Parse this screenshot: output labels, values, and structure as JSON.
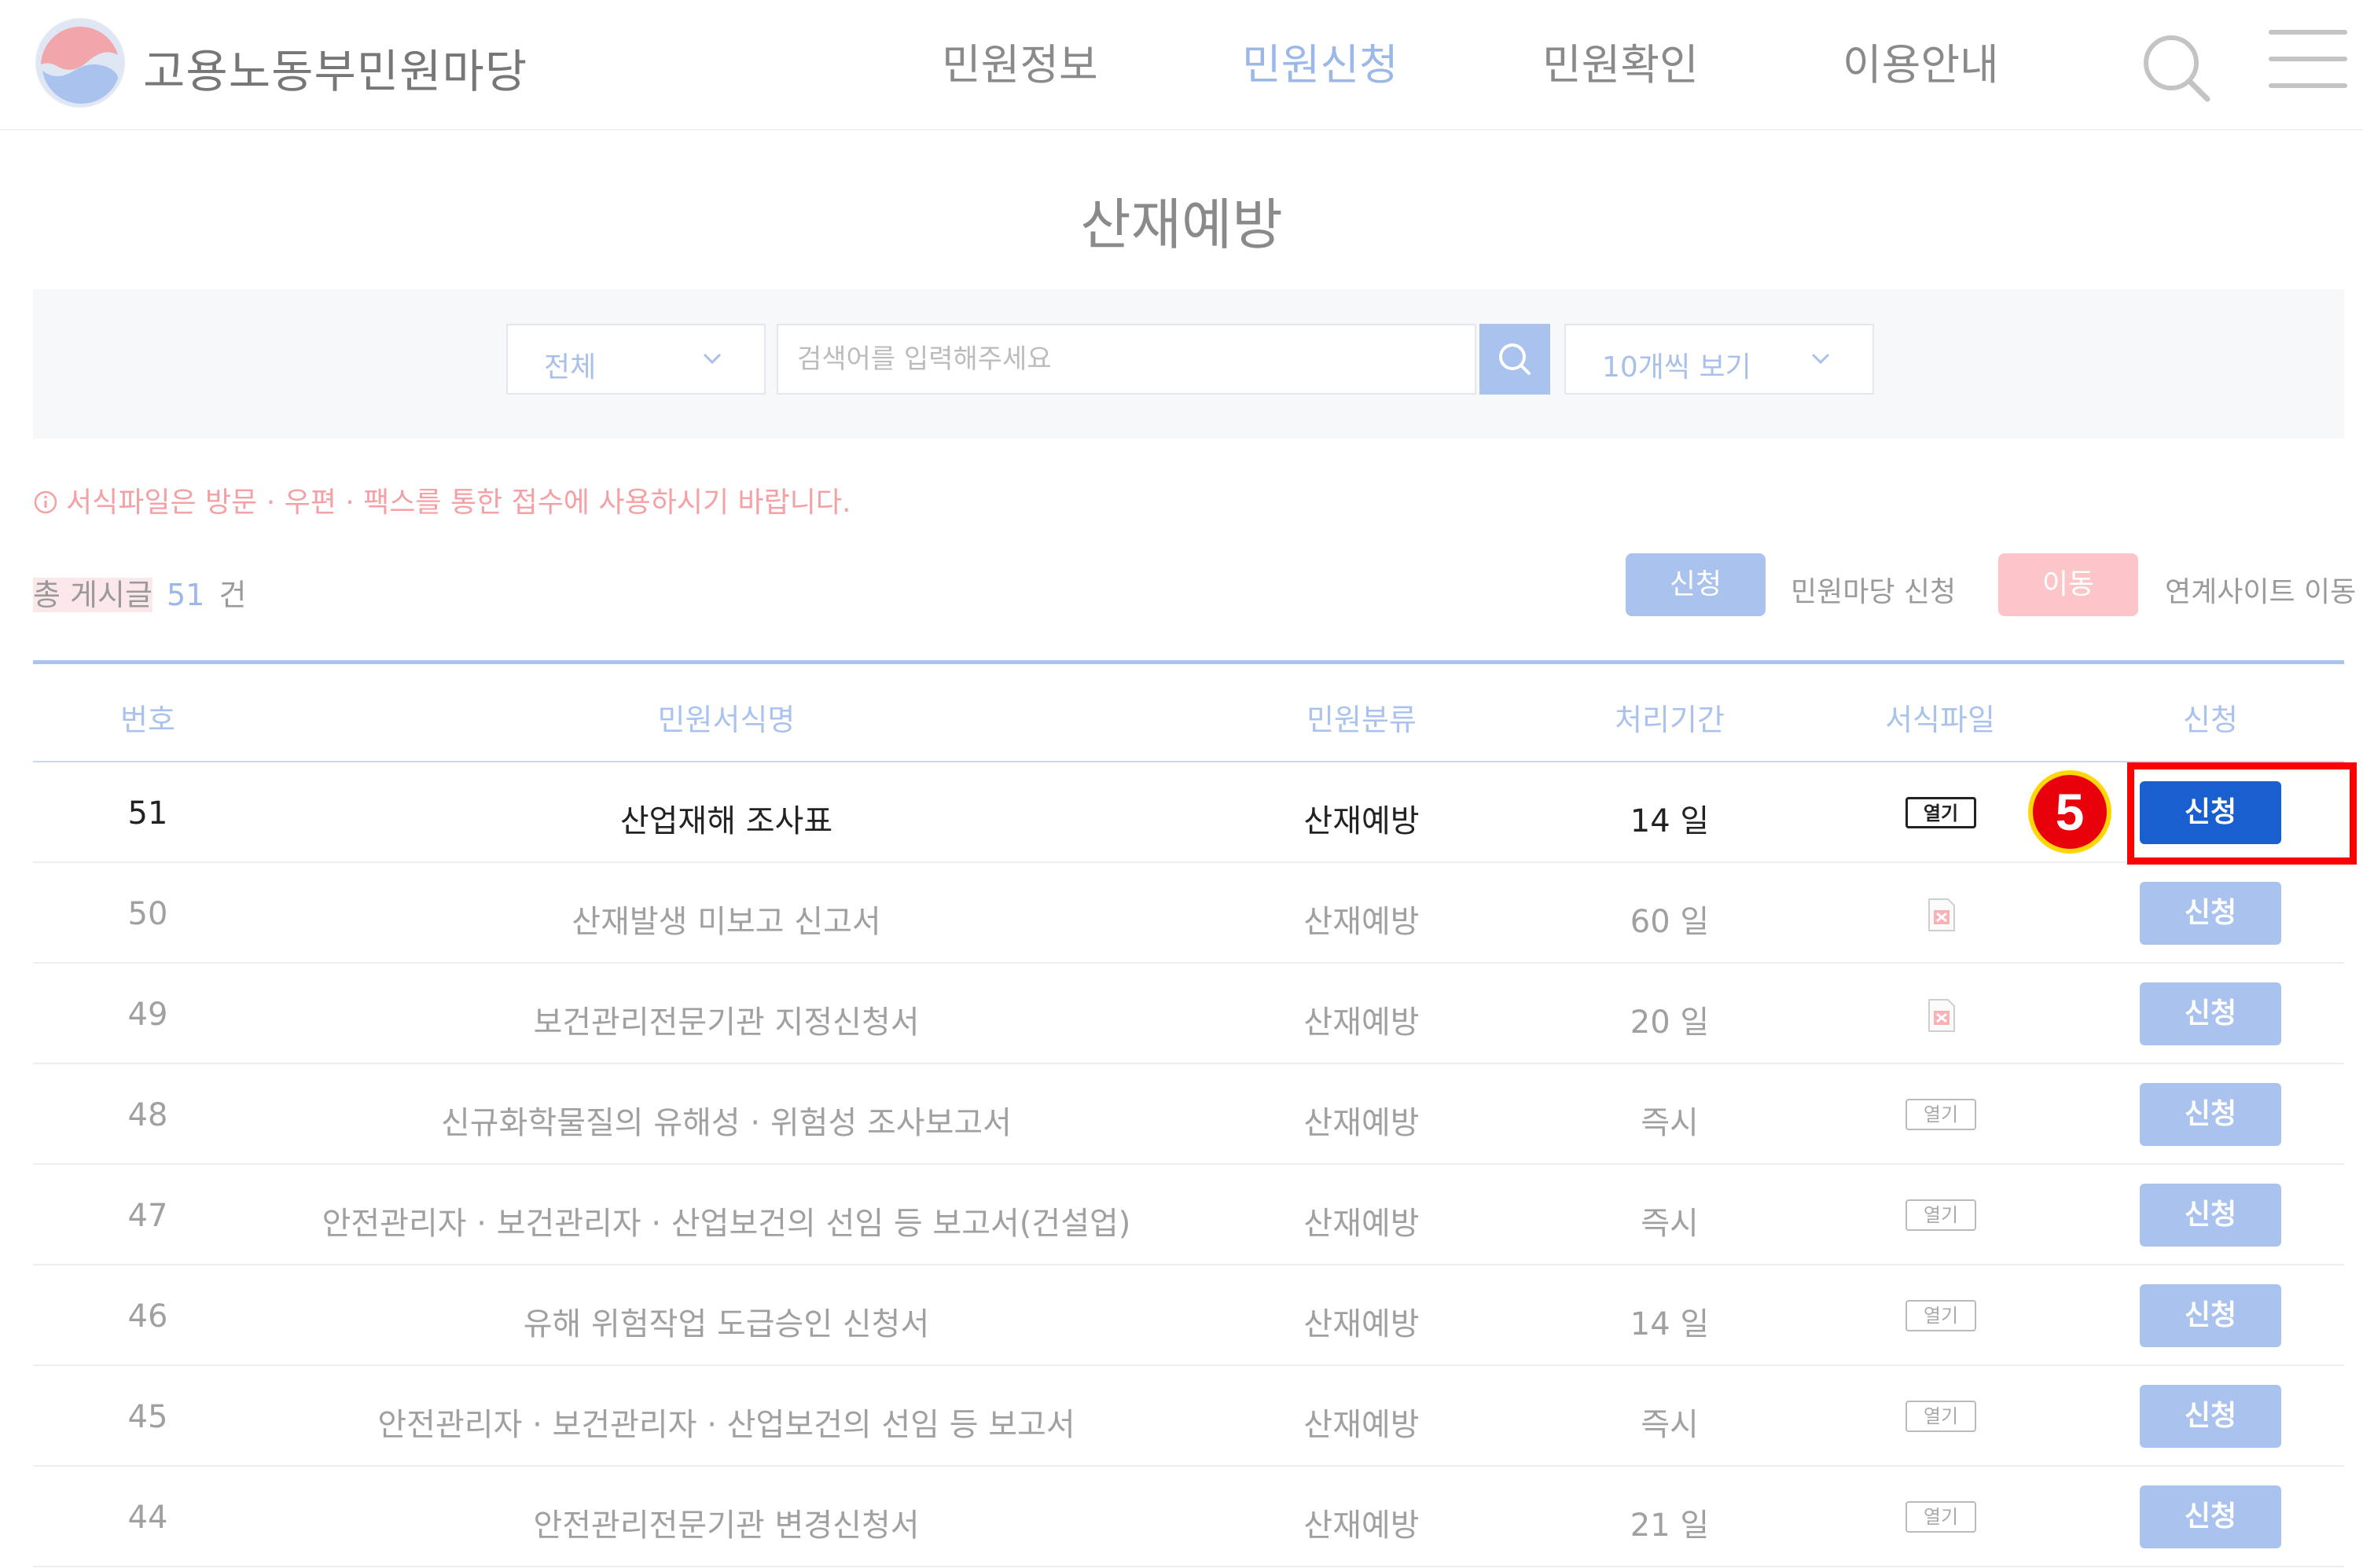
{
  "header": {
    "brand": "고용노동부민원마당",
    "nav": [
      "민원정보",
      "민원신청",
      "민원확인",
      "이용안내"
    ],
    "active_nav": "민원신청",
    "brand_color": "#9bb8e8"
  },
  "page": {
    "title": "산재예방"
  },
  "search": {
    "category_selected": "전체",
    "placeholder": "검색어를 입력해주세요",
    "count_selected": "10개씩 보기"
  },
  "notice": {
    "text": "서식파일은 방문 · 우편 · 팩스를 통한 접수에 사용하시기 바랍니다."
  },
  "summary": {
    "total_label": "총 게시글",
    "total_count": "51",
    "total_unit": "건",
    "legend_apply_button": "신청",
    "legend_apply_text": "민원마당 신청",
    "legend_move_button": "이동",
    "legend_move_text": "연계사이트 이동"
  },
  "table": {
    "columns": [
      "번호",
      "민원서식명",
      "민원분류",
      "처리기간",
      "서식파일",
      "신청"
    ],
    "rows": [
      {
        "no": "51",
        "name": "산업재해 조사표",
        "category": "산재예방",
        "period": "14 일",
        "file": "열기",
        "file_type": "open",
        "apply": "신청"
      },
      {
        "no": "50",
        "name": "산재발생 미보고 신고서",
        "category": "산재예방",
        "period": "60 일",
        "file": "",
        "file_type": "hwp",
        "apply": "신청"
      },
      {
        "no": "49",
        "name": "보건관리전문기관 지정신청서",
        "category": "산재예방",
        "period": "20 일",
        "file": "",
        "file_type": "hwp",
        "apply": "신청"
      },
      {
        "no": "48",
        "name": "신규화학물질의 유해성 · 위험성 조사보고서",
        "category": "산재예방",
        "period": "즉시",
        "file": "열기",
        "file_type": "open",
        "apply": "신청"
      },
      {
        "no": "47",
        "name": "안전관리자 · 보건관리자 · 산업보건의 선임 등 보고서(건설업)",
        "category": "산재예방",
        "period": "즉시",
        "file": "열기",
        "file_type": "open",
        "apply": "신청"
      },
      {
        "no": "46",
        "name": "유해 위험작업 도급승인 신청서",
        "category": "산재예방",
        "period": "14 일",
        "file": "열기",
        "file_type": "open",
        "apply": "신청"
      },
      {
        "no": "45",
        "name": "안전관리자 · 보건관리자 · 산업보건의 선임 등 보고서",
        "category": "산재예방",
        "period": "즉시",
        "file": "열기",
        "file_type": "open",
        "apply": "신청"
      },
      {
        "no": "44",
        "name": "안전관리전문기관 변경신청서",
        "category": "산재예방",
        "period": "21 일",
        "file": "열기",
        "file_type": "open",
        "apply": "신청"
      }
    ]
  },
  "annotation": {
    "step": "5",
    "highlight_color": "#ff0000"
  }
}
